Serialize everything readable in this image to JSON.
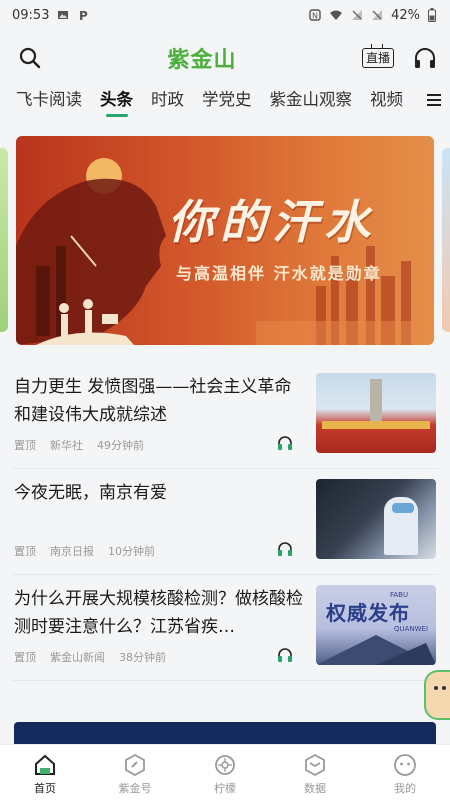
{
  "status_bar": {
    "time": "09:53",
    "battery": "42%"
  },
  "header": {
    "logo": "紫金山",
    "live_label": "直播"
  },
  "tabs": [
    {
      "label": "飞卡阅读"
    },
    {
      "label": "头条"
    },
    {
      "label": "时政"
    },
    {
      "label": "学党史"
    },
    {
      "label": "紫金山观察"
    },
    {
      "label": "视频"
    }
  ],
  "active_tab_index": 1,
  "banner": {
    "title": "你的汗水",
    "subtitle": "与高温相伴  汗水就是勋章"
  },
  "news": [
    {
      "title": "自力更生 发愤图强——社会主义革命和建设伟大成就综述",
      "tag": "置顶",
      "source": "新华社",
      "time": "49分钟前"
    },
    {
      "title": "今夜无眠，南京有爱",
      "tag": "置顶",
      "source": "南京日报",
      "time": "10分钟前"
    },
    {
      "title": "为什么开展大规模核酸检测？做核酸检测时要注意什么？江苏省疾…",
      "tag": "置顶",
      "source": "紫金山新闻",
      "time": "38分钟前",
      "thumb_text": "权威发布",
      "thumb_small": "FABU",
      "thumb_small2": "QUANWEI"
    }
  ],
  "tabbar": [
    {
      "label": "首页",
      "icon": "home-icon"
    },
    {
      "label": "紫金号",
      "icon": "zijin-icon"
    },
    {
      "label": "柠檬",
      "icon": "lemon-icon"
    },
    {
      "label": "数据",
      "icon": "data-icon"
    },
    {
      "label": "我的",
      "icon": "profile-icon"
    }
  ],
  "active_tabbar_index": 0,
  "colors": {
    "accent": "#2aa56a",
    "logo": "#4caf3c",
    "banner": "#c94a23"
  }
}
